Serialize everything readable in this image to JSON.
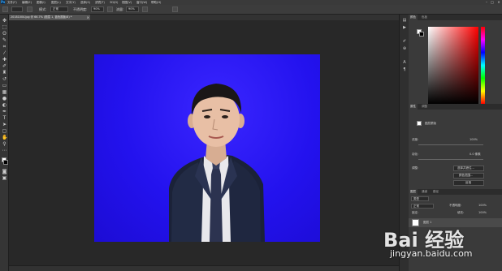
{
  "app": {
    "logo": "Ps",
    "menus": [
      "文件(F)",
      "编辑(E)",
      "图像(I)",
      "图层(L)",
      "文字(Y)",
      "选择(S)",
      "滤镜(T)",
      "3D(D)",
      "视图(V)",
      "窗口(W)",
      "帮助(H)"
    ],
    "window_controls": [
      "–",
      "□",
      "✕"
    ]
  },
  "options_bar": {
    "mode_label": "模式:",
    "mode_value": "正常",
    "opacity_label": "不透明度:",
    "opacity_value": "90%",
    "flow_label": "流量:",
    "flow_value": "90%"
  },
  "document": {
    "tab_title": "20181004.jpg @ 66.7% (图层 1, 蓝色图板/8) *",
    "tab_close": "×"
  },
  "panels": {
    "color_tabs": [
      "颜色",
      "色板"
    ],
    "adjust_tabs": [
      "属性",
      "调整"
    ],
    "properties_title": "图层蒙版",
    "density_label": "浓度:",
    "density_value": "100%",
    "feather_label": "羽化:",
    "feather_value": "0.0 像素",
    "refine_label": "调整:",
    "btn_select_mask": "选择并遮住...",
    "btn_color_range": "颜色范围...",
    "btn_invert": "反相",
    "layer_tabs": [
      "图层",
      "通道",
      "路径"
    ],
    "kind_label": "类型",
    "blend_value": "正常",
    "layer_opacity_label": "不透明度:",
    "layer_opacity_value": "100%",
    "lock_label": "锁定:",
    "fill_label": "填充:",
    "fill_value": "100%",
    "layer_name": "图层 1"
  },
  "colors": {
    "photo_background": "#2312ee",
    "foreground": "#ffffff",
    "background": "#000000",
    "ui_dark": "#282828",
    "ui_panel": "#3a3a3a"
  },
  "watermark": {
    "logo": "Bai 经验",
    "url": "jingyan.baidu.com"
  },
  "icons": {
    "tools": [
      "move-icon",
      "marquee-icon",
      "lasso-icon",
      "quick-select-icon",
      "crop-icon",
      "eyedropper-icon",
      "healing-icon",
      "brush-icon",
      "stamp-icon",
      "history-brush-icon",
      "eraser-icon",
      "gradient-icon",
      "blur-icon",
      "dodge-icon",
      "pen-icon",
      "type-icon",
      "path-select-icon",
      "rectangle-icon",
      "hand-icon",
      "zoom-icon"
    ]
  }
}
